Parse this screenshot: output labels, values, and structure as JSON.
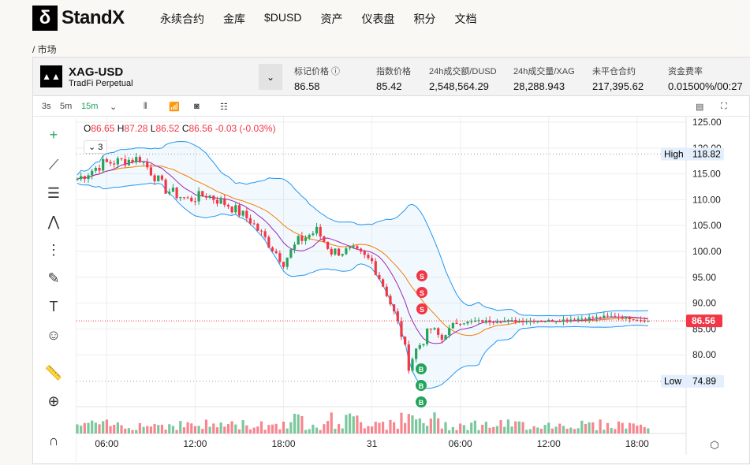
{
  "brand": {
    "name": "StandX",
    "mark": "δ"
  },
  "nav": [
    "永续合约",
    "金库",
    "$DUSD",
    "资产",
    "仪表盘",
    "积分",
    "文档"
  ],
  "breadcrumb": "/ 市场",
  "ticker": {
    "symbol": "XAG-USD",
    "subtitle": "TradFi Perpetual",
    "stats": [
      {
        "label": "标记价格 ⓘ",
        "value": "86.58"
      },
      {
        "label": "指数价格",
        "value": "85.42"
      },
      {
        "label": "24h成交额/DUSD",
        "value": "2,548,564.29"
      },
      {
        "label": "24h成交量/XAG",
        "value": "28,288.943"
      },
      {
        "label": "未平仓合约",
        "value": "217,395.62"
      },
      {
        "label": "资金费率",
        "value": "0.01500%/00:27"
      }
    ]
  },
  "toolbar": {
    "intervals": [
      "3s",
      "5m",
      "15m"
    ],
    "active": "15m"
  },
  "ohlc": {
    "o_label": "O",
    "o": "86.65",
    "h_label": "H",
    "h": "87.28",
    "l_label": "L",
    "l": "86.52",
    "c_label": "C",
    "c": "86.56",
    "chg": "-0.03 (-0.03%)"
  },
  "indicator_count": "3",
  "markers": {
    "high_label": "High",
    "high": "118.82",
    "low_label": "Low",
    "low": "74.89",
    "last": "86.56"
  },
  "colors": {
    "up": "#22a45a",
    "down": "#f23645",
    "band": "#2196f3",
    "ma1": "#f57c00",
    "ma2": "#9c27b0"
  },
  "chart_data": {
    "type": "candlestick",
    "ylim": [
      72,
      125
    ],
    "y_ticks": [
      "125.00",
      "120.00",
      "115.00",
      "110.00",
      "105.00",
      "100.00",
      "95.00",
      "90.00",
      "85.00",
      "80.00"
    ],
    "y_tick_values": [
      125,
      120,
      115,
      110,
      105,
      100,
      95,
      90,
      85,
      80
    ],
    "x_ticks": [
      "06:00",
      "12:00",
      "18:00",
      "31",
      "06:00",
      "12:00",
      "18:00"
    ],
    "x_tick_candle_index": [
      8,
      32,
      56,
      80,
      104,
      128,
      152
    ],
    "price_path": [
      [
        0,
        114
      ],
      [
        7,
        117
      ],
      [
        17,
        118
      ],
      [
        24,
        112
      ],
      [
        30,
        110
      ],
      [
        35,
        111
      ],
      [
        41,
        109
      ],
      [
        47,
        106
      ],
      [
        56,
        98
      ],
      [
        60,
        102
      ],
      [
        65,
        104
      ],
      [
        69,
        100
      ],
      [
        75,
        100
      ],
      [
        80,
        98
      ],
      [
        84,
        92
      ],
      [
        88,
        84
      ],
      [
        90,
        78
      ],
      [
        92,
        81
      ],
      [
        96,
        85
      ],
      [
        99,
        83
      ],
      [
        102,
        86
      ],
      [
        108,
        86.5
      ],
      [
        129,
        86.6
      ],
      [
        146,
        87.5
      ],
      [
        155,
        86.56
      ]
    ],
    "sell_markers": [
      "S",
      "S",
      "S"
    ],
    "buy_markers": [
      "B",
      "B",
      "B"
    ]
  }
}
